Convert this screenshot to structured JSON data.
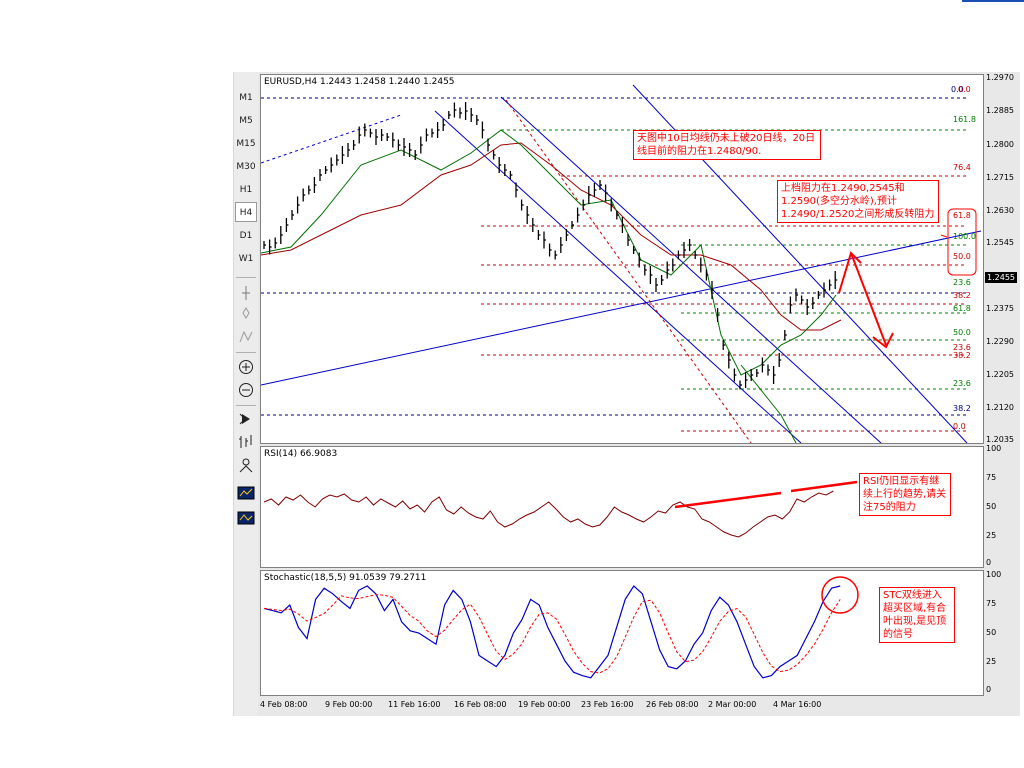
{
  "chart_header": {
    "main": "EURUSD,H4  1.2443 1.2458 1.2440 1.2455",
    "rsi": "RSI(14)  66.9083",
    "stoch": "Stochastic(18,5,5)  91.0539  79.2711"
  },
  "timeframes": [
    "M1",
    "M5",
    "M15",
    "M30",
    "H1",
    "H4",
    "D1",
    "W1"
  ],
  "active_timeframe": "H4",
  "price_axis": [
    "1.2970",
    "1.2885",
    "1.2800",
    "1.2715",
    "1.2630",
    "1.2545",
    "1.2455",
    "1.2375",
    "1.2290",
    "1.2205",
    "1.2120",
    "1.2035"
  ],
  "current_price": "1.2455",
  "rsi_axis": [
    "100",
    "75",
    "50",
    "25",
    "0"
  ],
  "stoch_axis": [
    "100",
    "75",
    "50",
    "25",
    "0"
  ],
  "time_axis": [
    "4 Feb 08:00",
    "9 Feb 00:00",
    "11 Feb 16:00",
    "16 Feb 08:00",
    "19 Feb 00:00",
    "23 Feb 16:00",
    "26 Feb 08:00",
    "2 Mar 00:00",
    "4 Mar 16:00"
  ],
  "fib_top": [
    "0.0",
    "100.0",
    "161.8",
    "76.4",
    "61.8",
    "100.0",
    "50.0",
    "23.6",
    "38.2",
    "61.8",
    "50.0",
    "23.6",
    "38.2",
    "23.6",
    "38.2",
    "0.0"
  ],
  "fib_top_extra": "0.0",
  "notes": {
    "note1": "天图中10日均线仍未上破20日线，20日线目前的阻力在1.2480/90.",
    "note2": "上档阻力在1.2490,2545和1.2590(多空分水岭),预计1.2490/1.2520之间形成反转阻力",
    "note3": "RSI仍旧显示有继续上行的趋势,请关注75的阻力",
    "note4": "STC双线进入超买区域,有合叶出现,是见顶的信号"
  },
  "colors": {
    "candle": "#000000",
    "ma_red": "#a00000",
    "ma_green": "#007000",
    "channel": "#0000cc",
    "fib_red": "#cc0000",
    "fib_green": "#008000",
    "annotation": "#ff0000",
    "stoch_main": "#0000cc",
    "stoch_signal": "#ff0000",
    "rsi": "#800000"
  }
}
